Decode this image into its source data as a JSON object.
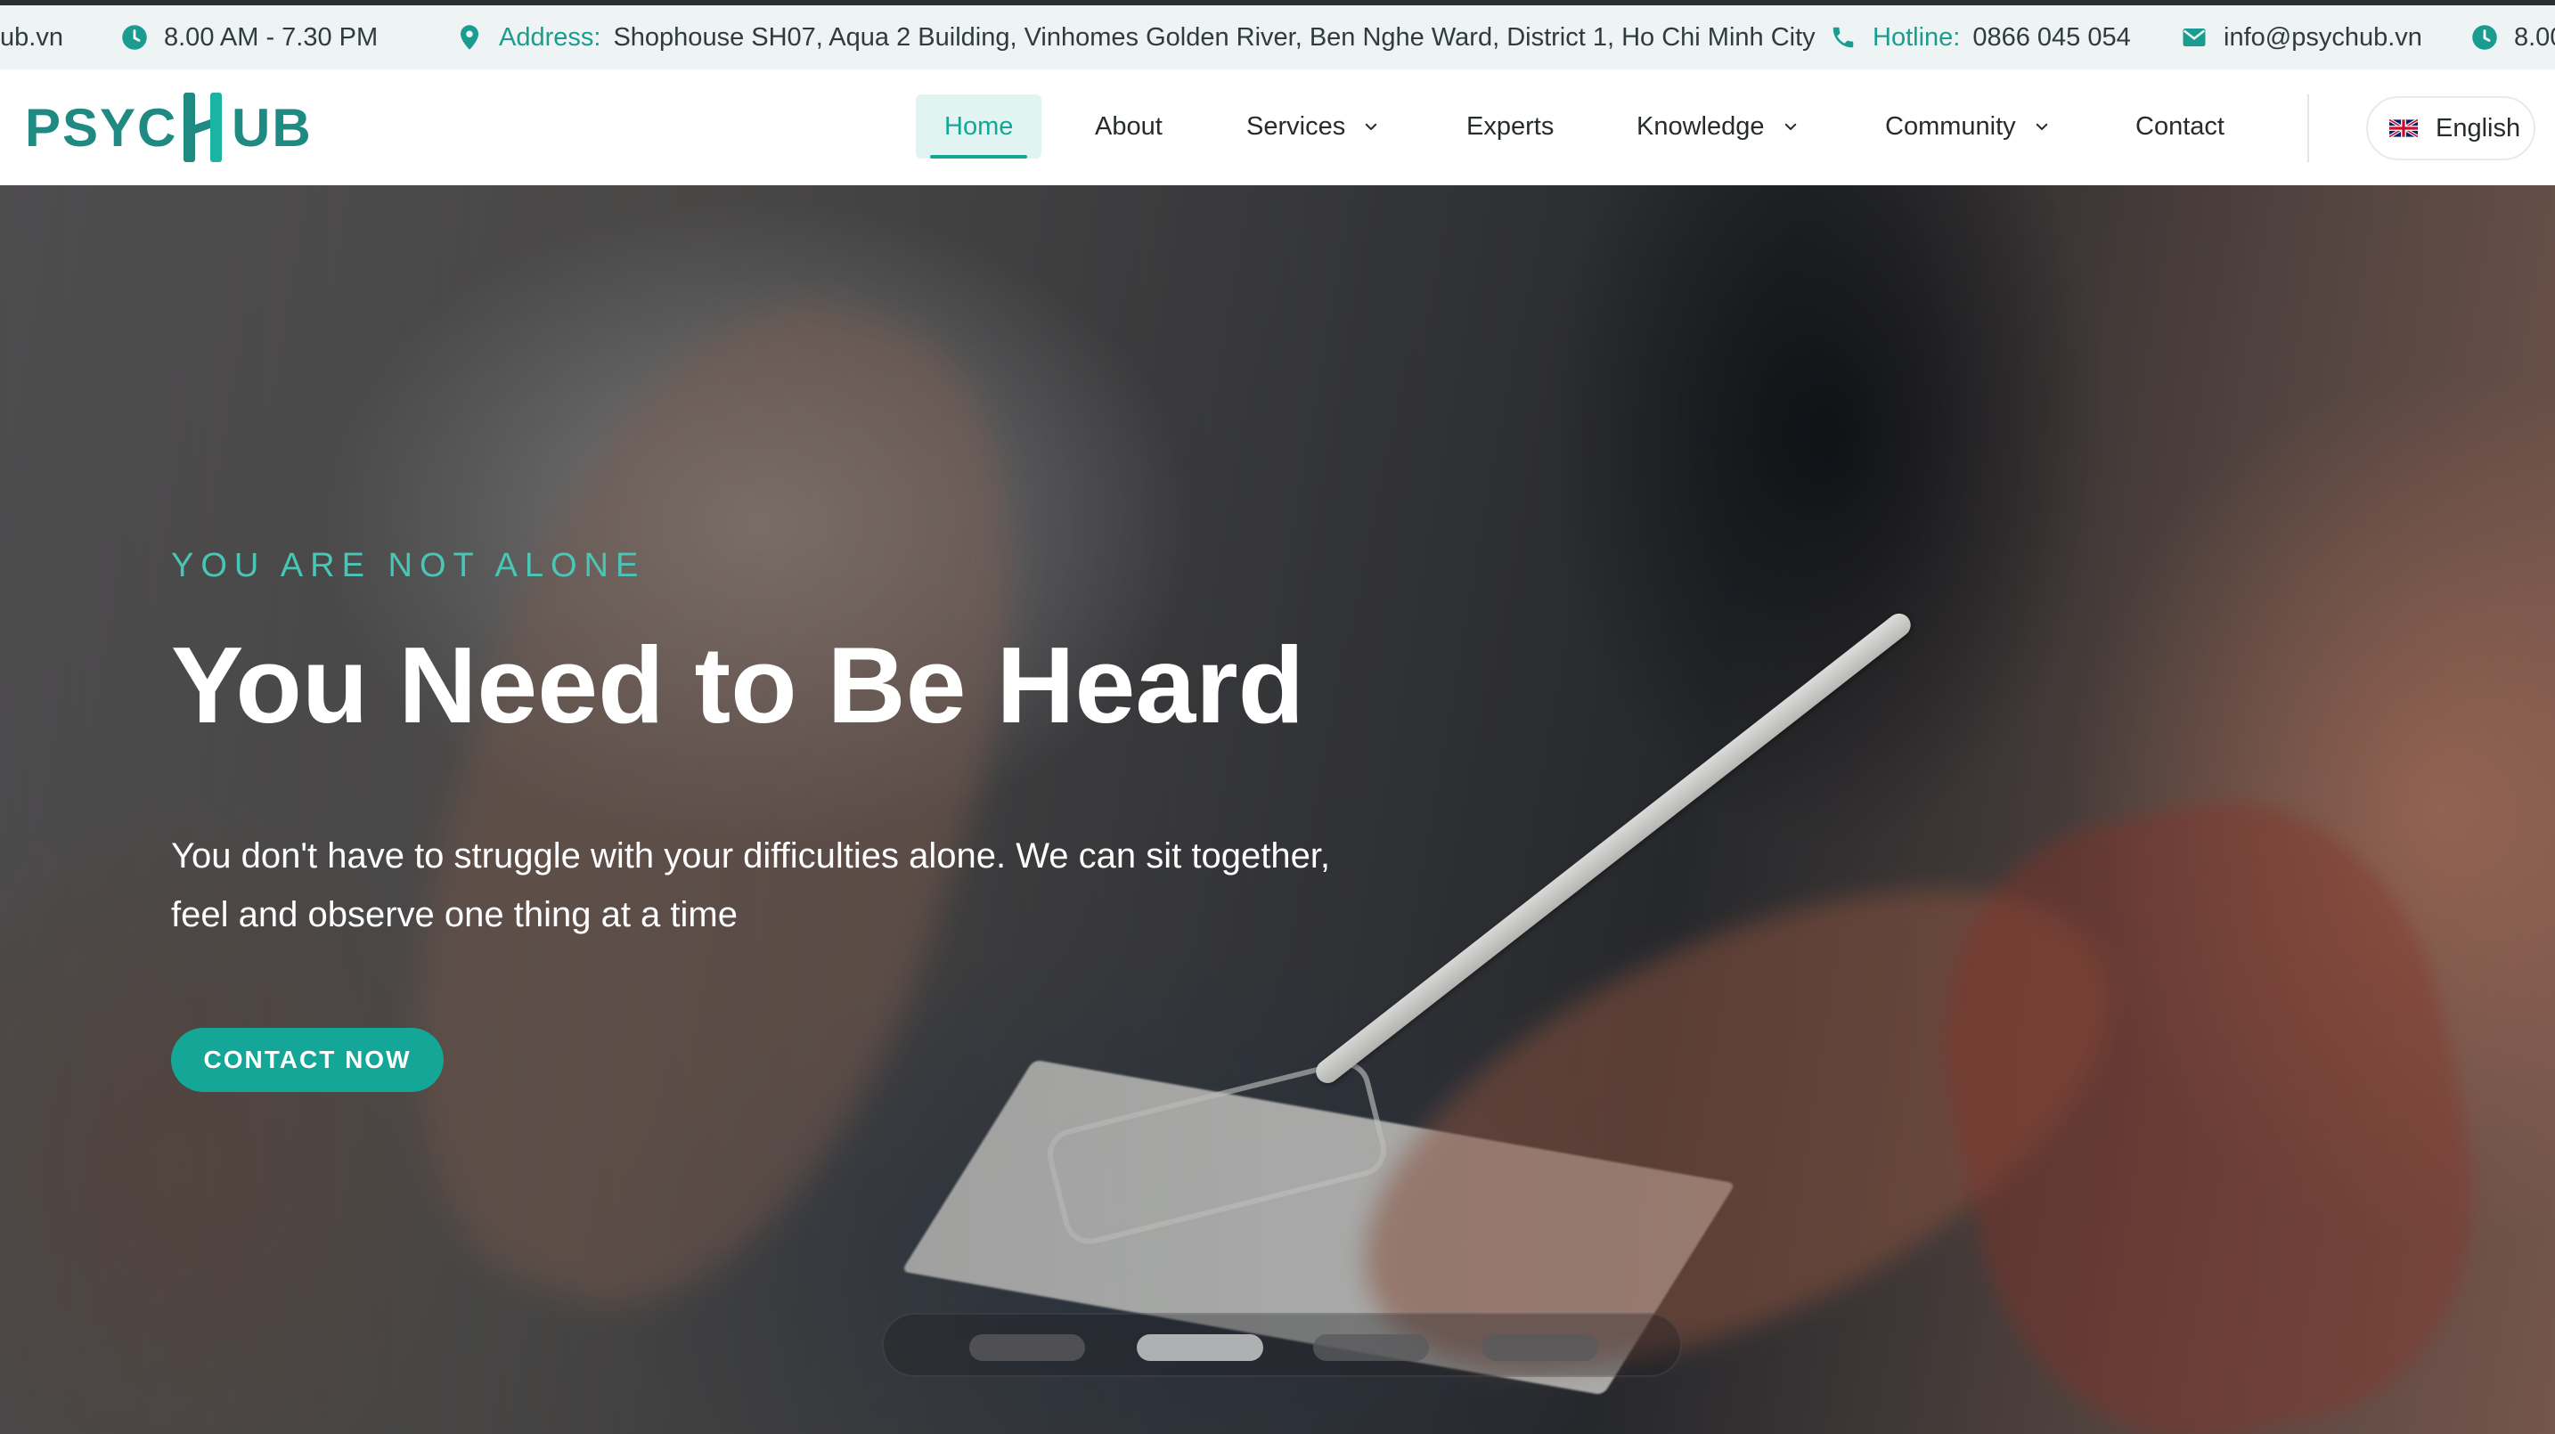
{
  "info_bar": {
    "clipped_email": "ub.vn",
    "hours": "8.00 AM - 7.30 PM",
    "address_label": "Address:",
    "address": "Shophouse SH07, Aqua 2 Building, Vinhomes Golden River, Ben Nghe Ward, District 1, Ho Chi Minh City",
    "hotline_label": "Hotline:",
    "hotline": "0866 045 054",
    "email": "info@psychub.vn",
    "hours_repeat": "8.00"
  },
  "header": {
    "logo_left": "PSYC",
    "logo_right": "UB",
    "nav": [
      {
        "label": "Home",
        "active": true
      },
      {
        "label": "About"
      },
      {
        "label": "Services",
        "dropdown": true
      },
      {
        "label": "Experts"
      },
      {
        "label": "Knowledge",
        "dropdown": true
      },
      {
        "label": "Community",
        "dropdown": true
      },
      {
        "label": "Contact"
      }
    ],
    "language": "English"
  },
  "hero": {
    "eyebrow": "YOU ARE NOT ALONE",
    "headline": "You Need to Be Heard",
    "subtext_line1": "You don't have to struggle with your difficulties alone. We can sit together,",
    "subtext_line2": "feel and observe one thing at a time",
    "cta": "CONTACT NOW",
    "slides_total": 4,
    "active_slide": 2
  },
  "colors": {
    "accent": "#14a697",
    "eyebrow": "#48c7b6",
    "logo_dark": "#1f8a82",
    "info_bar_bg": "#eef4f3"
  },
  "icons": {
    "clock": "clock-icon",
    "address": "map-pin-icon",
    "hotline": "phone-icon",
    "email": "mail-icon",
    "dropdown": "chevron-down-icon",
    "language": "uk-flag-icon"
  }
}
